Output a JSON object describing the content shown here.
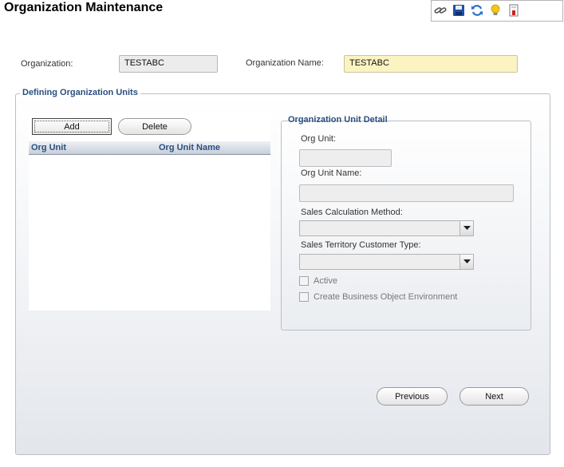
{
  "page": {
    "title": "Organization Maintenance"
  },
  "toolbar": {
    "icons": [
      "link-icon",
      "save-icon",
      "refresh-icon",
      "hint-bulb-icon",
      "report-icon"
    ]
  },
  "organization": {
    "label": "Organization:",
    "value": "TESTABC",
    "name_label": "Organization Name:",
    "name_value": "TESTABC"
  },
  "units_section": {
    "legend": "Defining Organization Units",
    "add_label": "Add",
    "delete_label": "Delete",
    "columns": [
      "Org Unit",
      "Org Unit Name"
    ],
    "rows": []
  },
  "detail": {
    "legend": "Organization Unit Detail",
    "org_unit_label": "Org Unit:",
    "org_unit_value": "",
    "org_unit_name_label": "Org Unit Name:",
    "org_unit_name_value": "",
    "sales_calc_label": "Sales Calculation Method:",
    "sales_calc_value": "",
    "territory_label": "Sales Territory Customer Type:",
    "territory_value": "",
    "active_label": "Active",
    "active_checked": false,
    "create_env_label": "Create Business Object Environment",
    "create_env_checked": false
  },
  "nav": {
    "previous_label": "Previous",
    "next_label": "Next"
  },
  "colors": {
    "accent": "#2a4f80",
    "name_field_bg": "#fbf4c2",
    "readonly_bg": "#ececec"
  }
}
